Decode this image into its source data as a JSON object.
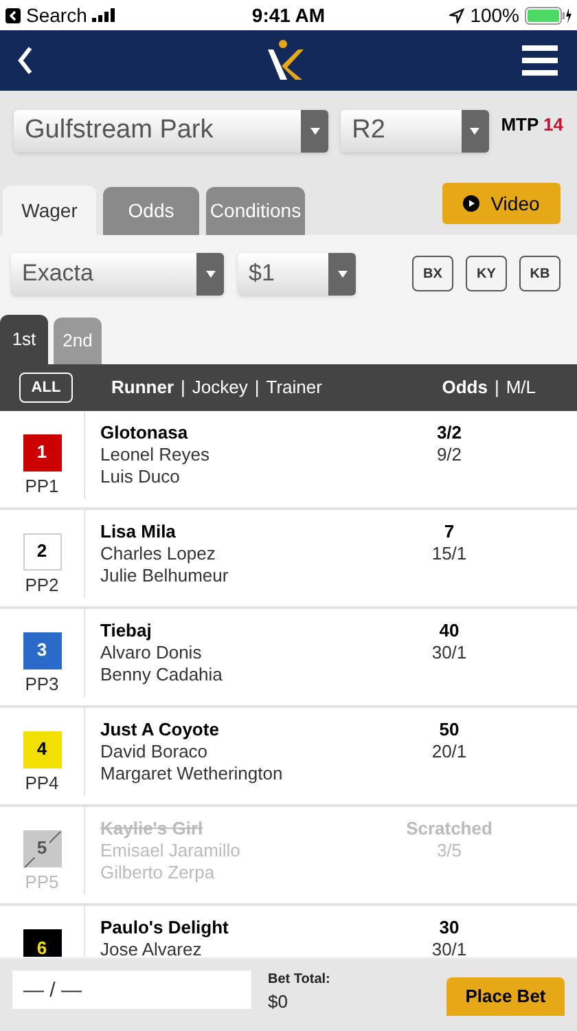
{
  "status_bar": {
    "back_label": "Search",
    "time": "9:41 AM",
    "battery": "100%"
  },
  "track_select": {
    "value": "Gulfstream Park"
  },
  "race_select": {
    "value": "R2"
  },
  "mtp": {
    "label": "MTP",
    "value": "14"
  },
  "tabs": [
    {
      "label": "Wager",
      "selected": true
    },
    {
      "label": "Odds",
      "selected": false
    },
    {
      "label": "Conditions",
      "selected": false
    }
  ],
  "video_button": "Video",
  "wager_select": {
    "value": "Exacta"
  },
  "amount_select": {
    "value": "$1"
  },
  "modifier_buttons": [
    "BX",
    "KY",
    "KB"
  ],
  "leg_tabs": [
    {
      "label": "1st",
      "selected": true
    },
    {
      "label": "2nd",
      "selected": false
    }
  ],
  "header": {
    "all_button": "ALL",
    "runner": "Runner",
    "sep_1": "|",
    "jockey": "Jockey",
    "sep_2": "|",
    "trainer": "Trainer",
    "odds": "Odds",
    "sep_3": "|",
    "ml": "M/L"
  },
  "runners": [
    {
      "number": "1",
      "pp": "PP1",
      "color": "#cc0000",
      "scratched": false,
      "name": "Glotonasa",
      "jockey": "Leonel Reyes",
      "trainer": "Luis Duco",
      "odds": "3/2",
      "ml": "9/2"
    },
    {
      "number": "2",
      "pp": "PP2",
      "color": "#ffffff",
      "scratched": false,
      "name": "Lisa Mila",
      "jockey": "Charles Lopez",
      "trainer": "Julie Belhumeur",
      "odds": "7",
      "ml": "15/1"
    },
    {
      "number": "3",
      "pp": "PP3",
      "color": "#2a6ac8",
      "scratched": false,
      "name": "Tiebaj",
      "jockey": "Alvaro Donis",
      "trainer": "Benny Cadahia",
      "odds": "40",
      "ml": "30/1"
    },
    {
      "number": "4",
      "pp": "PP4",
      "color": "#f2e000",
      "scratched": false,
      "name": "Just A Coyote",
      "jockey": "David Boraco",
      "trainer": "Margaret Wetherington",
      "odds": "50",
      "ml": "20/1"
    },
    {
      "number": "5",
      "pp": "PP5",
      "color": "#c8c8c8",
      "scratched": true,
      "name": "Kaylie's Girl",
      "jockey": "Emisael Jaramillo",
      "trainer": "Gilberto Zerpa",
      "odds": "Scratched",
      "ml": "3/5"
    },
    {
      "number": "6",
      "color": "#000000",
      "scratched": false,
      "name": "Paulo's Delight",
      "jockey": "Jose Alvarez",
      "odds": "30",
      "ml": "30/1"
    }
  ],
  "bottom_bar": {
    "selection": "— / —",
    "total_label": "Bet Total:",
    "total": "$0",
    "place_button": "Place Bet"
  }
}
